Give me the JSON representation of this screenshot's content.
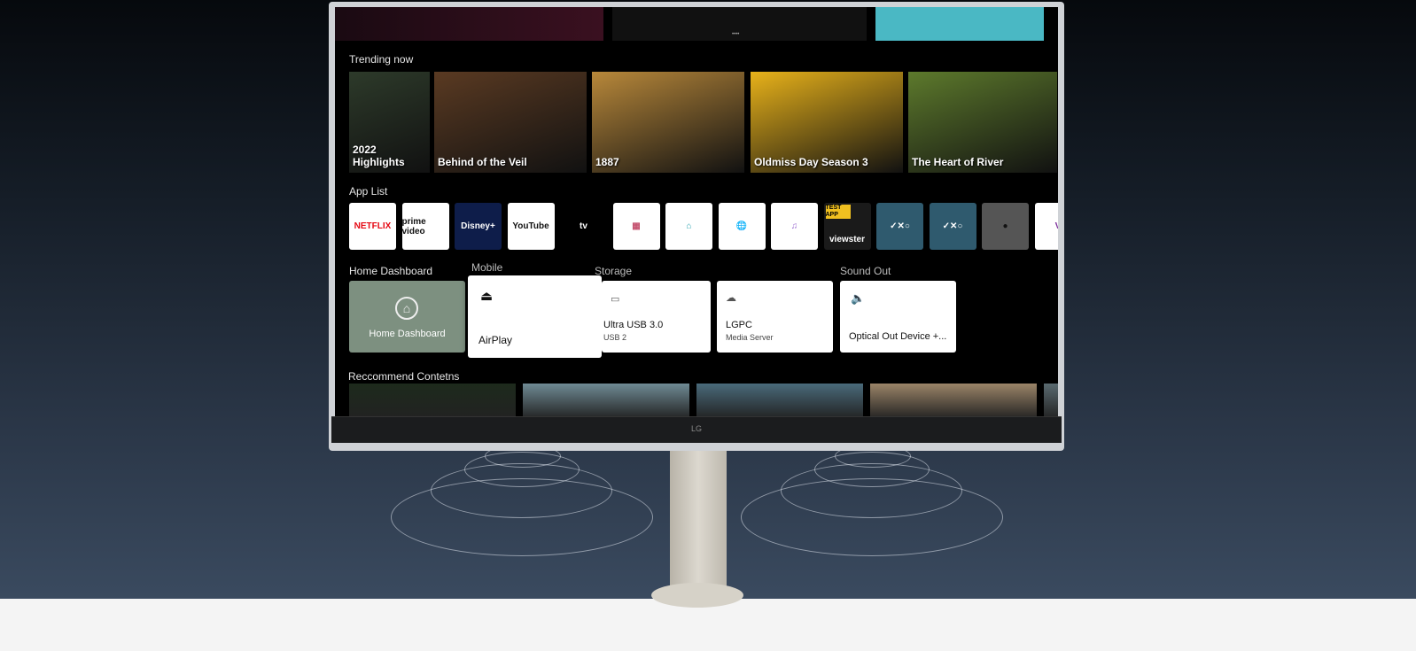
{
  "brand": "LG",
  "sections": {
    "trending": "Trending now",
    "apps": "App List",
    "home_dashboard": "Home Dashboard",
    "mobile": "Mobile",
    "storage": "Storage",
    "sound_out": "Sound Out",
    "recommend": "Reccommend Contetns"
  },
  "trending": [
    {
      "title": "2022 Highlights",
      "color": "#2d3a2a"
    },
    {
      "title": "Behind of the Veil",
      "color": "#5a3a22"
    },
    {
      "title": "1887",
      "color": "#b8883a"
    },
    {
      "title": "Oldmiss Day Season 3",
      "color": "#e8b21a"
    },
    {
      "title": "The Heart of River",
      "color": "#5d7a2c"
    }
  ],
  "apps": [
    {
      "name": "NETFLIX",
      "bg": "#ffffff",
      "fg": "#e50914"
    },
    {
      "name": "prime video",
      "bg": "#ffffff",
      "fg": "#111111"
    },
    {
      "name": "Disney+",
      "bg": "#0e1d4a",
      "fg": "#ffffff"
    },
    {
      "name": "YouTube",
      "bg": "#ffffff",
      "fg": "#111111"
    },
    {
      "name": "tv",
      "bg": "#000000",
      "fg": "#ffffff"
    },
    {
      "name": "▦",
      "bg": "#ffffff",
      "fg": "#c4506e"
    },
    {
      "name": "⌂",
      "bg": "#ffffff",
      "fg": "#2aa3b0"
    },
    {
      "name": "🌐",
      "bg": "#ffffff",
      "fg": "#2b8cc4"
    },
    {
      "name": "♫",
      "bg": "#ffffff",
      "fg": "#9a6ad0"
    },
    {
      "name": "viewster",
      "bg": "#1a1a1a",
      "fg": "#ffffff",
      "badge": "TEST APP"
    },
    {
      "name": "✓✕○",
      "bg": "#2f5a6e",
      "fg": "#ffffff"
    },
    {
      "name": "✓✕○",
      "bg": "#2f5a6e",
      "fg": "#ffffff"
    },
    {
      "name": "●",
      "bg": "#555555",
      "fg": "#111111"
    },
    {
      "name": "V",
      "bg": "#ffffff",
      "fg": "#7a2a9a"
    }
  ],
  "cards": {
    "home": {
      "title": "Home Dashboard"
    },
    "airplay": {
      "title": "AirPlay"
    },
    "usb": {
      "title": "Ultra USB 3.0",
      "sub": "USB 2"
    },
    "lgpc": {
      "title": "LGPC",
      "sub": "Media Server"
    },
    "sound": {
      "title": "Optical Out Device +..."
    }
  },
  "recommend": [
    {
      "color": "#1d2a1c"
    },
    {
      "color": "#6f8a94"
    },
    {
      "color": "#4a6a7a"
    },
    {
      "color": "#9a8468"
    },
    {
      "color": "#5a6a70"
    }
  ]
}
